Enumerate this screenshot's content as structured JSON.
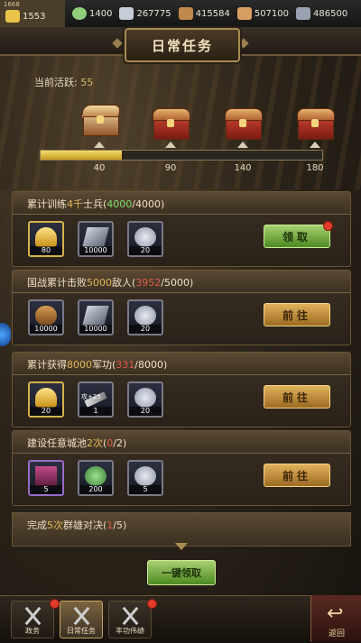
{
  "resources": [
    {
      "name": "gold-ingot",
      "value": "1553",
      "icon": "gold-ingot-icon",
      "color": "#e9c24a"
    },
    {
      "name": "jade",
      "value": "1400",
      "icon": "jade-icon",
      "color": "#8fcf7a"
    },
    {
      "name": "silver",
      "value": "267775",
      "icon": "silver-icon",
      "color": "#c7cdd8"
    },
    {
      "name": "wood",
      "value": "415584",
      "icon": "wood-icon",
      "color": "#c08a4a"
    },
    {
      "name": "food",
      "value": "507100",
      "icon": "food-icon",
      "color": "#d8a060"
    },
    {
      "name": "iron",
      "value": "486500",
      "icon": "iron-icon",
      "color": "#9aa2b2"
    }
  ],
  "vip_label": "1668",
  "title": "日常任务",
  "activity": {
    "label": "当前活跃:",
    "value": "55",
    "progress_fraction": 0.29,
    "milestones": [
      {
        "label": "40",
        "state": "open"
      },
      {
        "label": "90",
        "state": "closed"
      },
      {
        "label": "140",
        "state": "closed"
      },
      {
        "label": "180",
        "state": "closed"
      }
    ]
  },
  "tasks": [
    {
      "pre": "累计训练",
      "hl": "4千",
      "post": "士兵",
      "current": "4000",
      "total": "/4000",
      "cur_state": "done",
      "items": [
        {
          "type": "gold",
          "count": "80"
        },
        {
          "type": "iron",
          "count": "10000"
        },
        {
          "type": "coin",
          "count": "20"
        }
      ],
      "button": "领取",
      "button_type": "claim",
      "dot": true
    },
    {
      "pre": "国战累计击败",
      "hl": "5000",
      "post": "敌人",
      "current": "3952",
      "total": "/5000",
      "cur_state": "todo",
      "items": [
        {
          "type": "wood",
          "count": "10000"
        },
        {
          "type": "iron",
          "count": "10000"
        },
        {
          "type": "coin",
          "count": "20"
        }
      ],
      "button": "前往",
      "button_type": "go",
      "dot": false
    },
    {
      "pre": "累计获得",
      "hl": "8000",
      "post": "军功",
      "current": "331",
      "total": "/8000",
      "cur_state": "todo",
      "items": [
        {
          "type": "gold",
          "count": "20"
        },
        {
          "type": "blade",
          "count": "1",
          "label": "攻+25"
        },
        {
          "type": "coin",
          "count": "20"
        }
      ],
      "button": "前往",
      "button_type": "go",
      "dot": false
    },
    {
      "pre": "建设任意城池",
      "hl": "2次",
      "post": "",
      "current": "0",
      "total": "/2",
      "cur_state": "todo",
      "items": [
        {
          "type": "scroll",
          "count": "5"
        },
        {
          "type": "gem",
          "count": "200"
        },
        {
          "type": "coin",
          "count": "5"
        }
      ],
      "button": "前往",
      "button_type": "go",
      "dot": false
    }
  ],
  "task5": {
    "pre": "完成",
    "hl": "5次",
    "post": "群雄对决",
    "current": "1",
    "total": "/5"
  },
  "one_click_label": "一键领取",
  "nav": [
    {
      "label": "政务",
      "active": false,
      "dot": true
    },
    {
      "label": "日常任务",
      "active": true,
      "dot": false
    },
    {
      "label": "丰功伟绩",
      "active": false,
      "dot": true
    }
  ],
  "back_label": "返回"
}
